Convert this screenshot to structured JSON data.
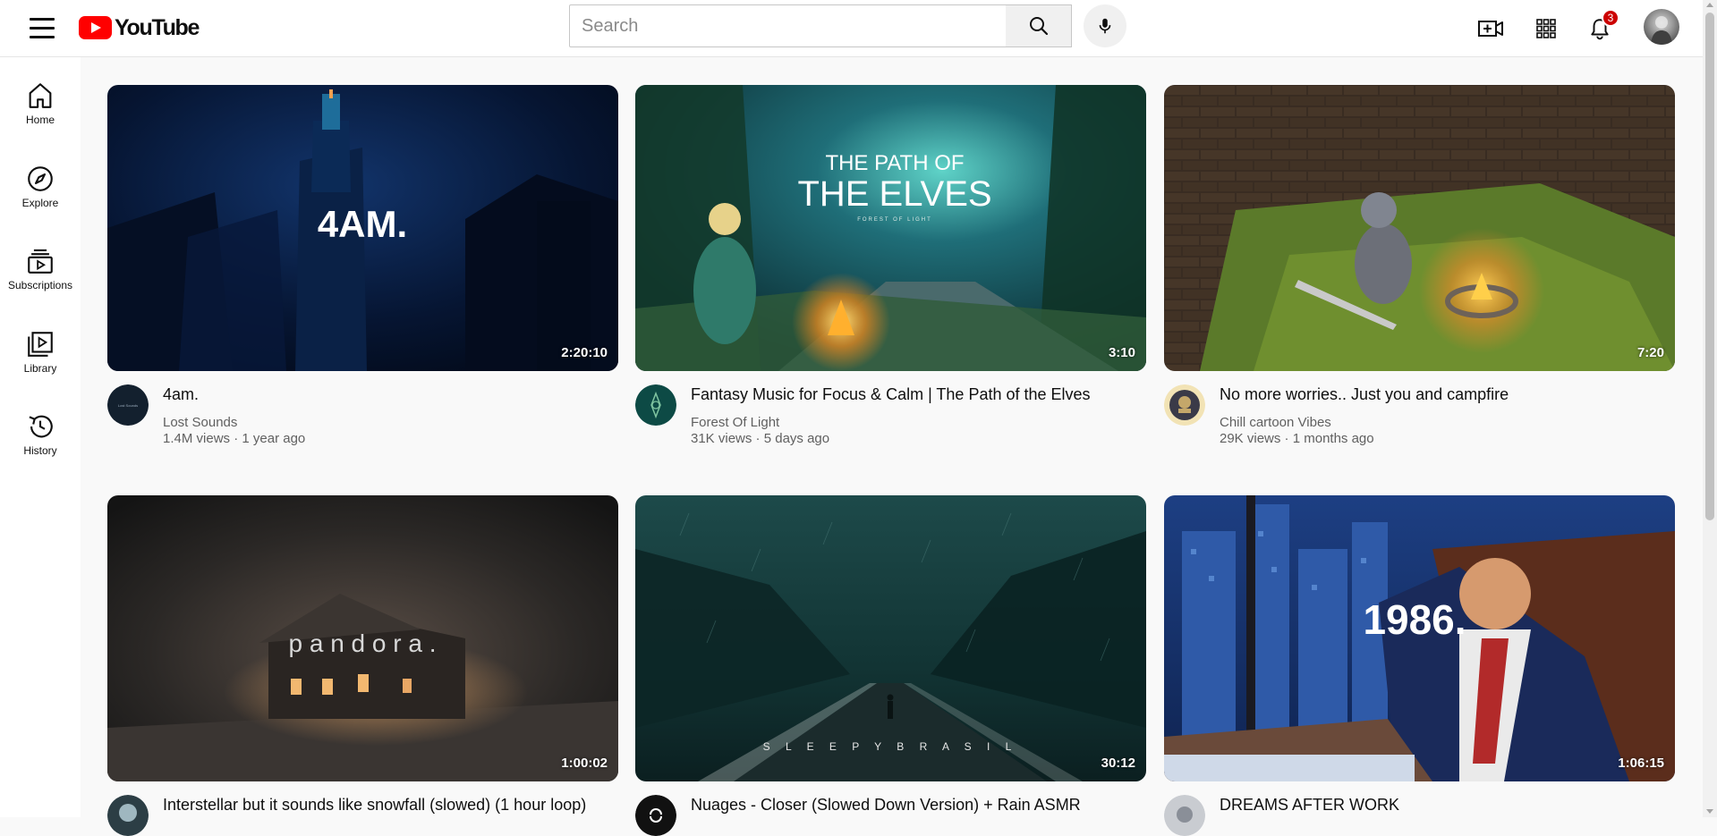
{
  "header": {
    "logo_text": "YouTube",
    "search_placeholder": "Search",
    "notification_count": "3",
    "brand_color": "#ff0000"
  },
  "sidebar": {
    "items": [
      {
        "label": "Home",
        "icon": "home-icon"
      },
      {
        "label": "Explore",
        "icon": "compass-icon"
      },
      {
        "label": "Subscriptions",
        "icon": "subscriptions-icon"
      },
      {
        "label": "Library",
        "icon": "library-icon"
      },
      {
        "label": "History",
        "icon": "history-icon"
      }
    ]
  },
  "videos": [
    {
      "title": "4am.",
      "channel": "Lost Sounds",
      "views": "1.4M views",
      "age": "1 year ago",
      "duration": "2:20:10",
      "thumb_text": "4AM."
    },
    {
      "title": "Fantasy Music for Focus & Calm | The Path of the Elves",
      "channel": "Forest Of Light",
      "views": "31K views",
      "age": "5 days ago",
      "duration": "3:10",
      "thumb_text_1": "THE PATH OF",
      "thumb_text_2": "THE ELVES",
      "thumb_text_3": "FOREST OF LIGHT"
    },
    {
      "title": "No more worries.. Just you and campfire",
      "channel": "Chill cartoon Vibes",
      "views": "29K views",
      "age": "1 months ago",
      "duration": "7:20"
    },
    {
      "title": "Interstellar but it sounds like snowfall (slowed) (1 hour loop)",
      "duration": "1:00:02",
      "thumb_text": "p a n d o r a ."
    },
    {
      "title": "Nuages - Closer (Slowed Down Version) + Rain ASMR",
      "duration": "30:12",
      "thumb_text": "S L E E P Y   B R A S I L"
    },
    {
      "title": "DREAMS AFTER WORK",
      "duration": "1:06:15",
      "thumb_text": "1986."
    }
  ]
}
